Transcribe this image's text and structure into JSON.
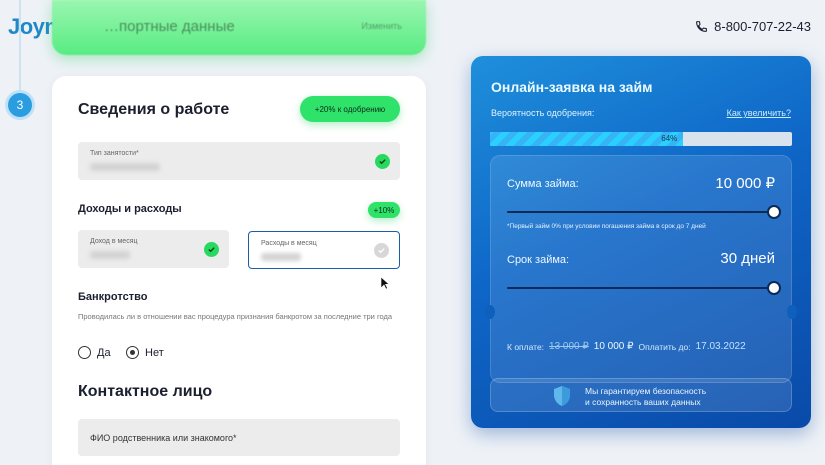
{
  "brand": {
    "logo": "Joymoney"
  },
  "header": {
    "phone": "8-800-707-22-43"
  },
  "steps": {
    "current_badge": "3",
    "prev_title": "…портные данные",
    "prev_action": "Изменить"
  },
  "work": {
    "title": "Сведения о работе",
    "approval_boost": "+20% к одобрению",
    "employment_label": "Тип занятости*",
    "income_section": "Доходы и расходы",
    "income_boost": "+10%",
    "income_label": "Доход в месяц",
    "expense_label": "Расходы в месяц",
    "bankruptcy_title": "Банкротство",
    "bankruptcy_question": "Проводилась ли в отношении вас процедура признания банкротом за последние три года",
    "opt_yes": "Да",
    "opt_no": "Нет",
    "selected": "Нет"
  },
  "contact": {
    "title": "Контактное лицо",
    "placeholder": "ФИО родственника или знакомого*"
  },
  "loan": {
    "title": "Онлайн-заявка на займ",
    "probability_label": "Вероятность одобрения:",
    "how_to_increase": "Как увеличить?",
    "probability_percent": 64,
    "probability_text": "64%",
    "amount_label": "Сумма займа:",
    "amount_value": "10 000 ₽",
    "amount_fraction": 1.0,
    "note": "*Первый займ 0% при условии погашения займа в срок до 7 дней",
    "term_label": "Срок займа:",
    "term_value": "30 дней",
    "term_fraction": 1.0,
    "pay_label": "К оплате:",
    "old_amount": "13 000 ₽",
    "new_amount": "10 000 ₽",
    "pay_until_label": "Оплатить до:",
    "pay_until_date": "17.03.2022",
    "guarantee_line1": "Мы гарантируем безопасность",
    "guarantee_line2": "и сохранность ваших данных"
  },
  "colors": {
    "accent_green": "#2fe36a",
    "panel_blue": "#0e66c7",
    "link": "#1e88c8"
  }
}
